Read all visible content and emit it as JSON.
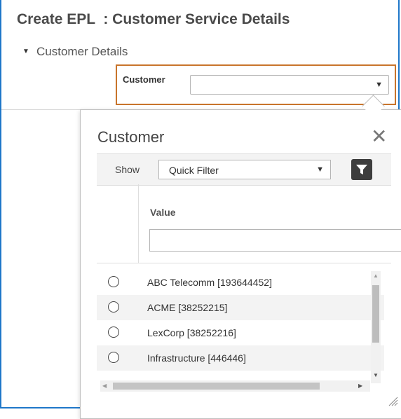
{
  "page": {
    "title": "Create EPL  : Customer Service Details"
  },
  "section": {
    "toggle_icon": "▼",
    "title": "Customer Details"
  },
  "customer_field": {
    "label": "Customer",
    "value": "",
    "arrow": "▼"
  },
  "popup": {
    "title": "Customer",
    "close_glyph": "✕",
    "filter_bar": {
      "show_label": "Show",
      "select_value": "Quick Filter",
      "select_arrow": "▼"
    },
    "column": {
      "header": "Value",
      "filter_value": ""
    },
    "rows": [
      {
        "label": "ABC Telecomm [193644452]",
        "selected": false
      },
      {
        "label": "ACME [38252215]",
        "selected": false
      },
      {
        "label": "LexCorp [38252216]",
        "selected": false
      },
      {
        "label": "Infrastructure [446446]",
        "selected": false
      }
    ],
    "scroll": {
      "up": "▲",
      "down": "▼",
      "left": "◀",
      "right": "▶"
    }
  },
  "colors": {
    "frame_border": "#1f77c9",
    "highlight_border": "#c8742b",
    "filter_button": "#3d3d3d",
    "row_alt": "#f3f3f3"
  }
}
